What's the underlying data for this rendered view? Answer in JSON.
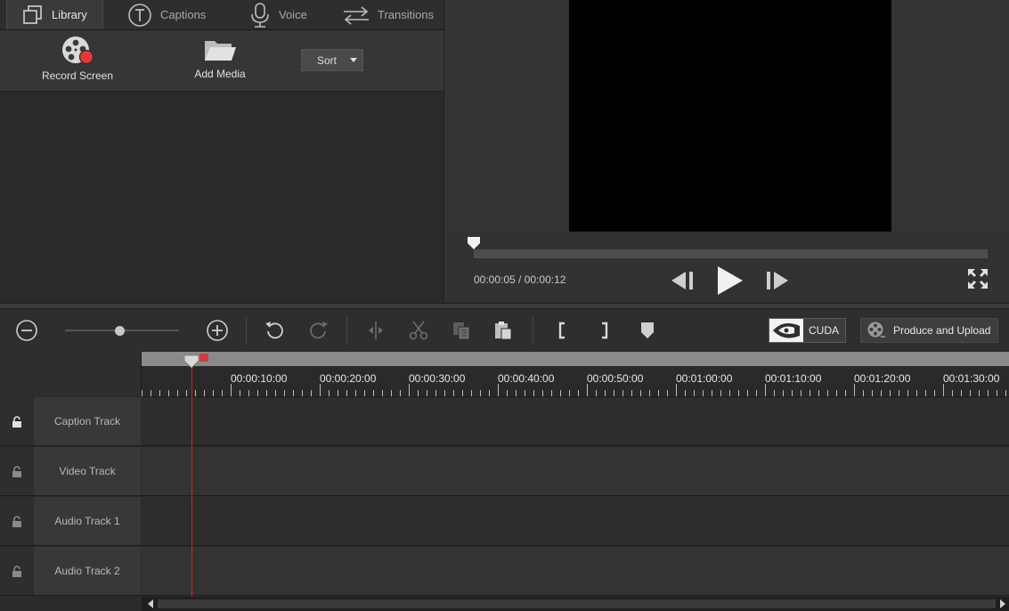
{
  "tabs": [
    {
      "label": "Library",
      "icon": "library-icon",
      "active": true
    },
    {
      "label": "Captions",
      "icon": "captions-icon",
      "active": false
    },
    {
      "label": "Voice",
      "icon": "microphone-icon",
      "active": false
    },
    {
      "label": "Transitions",
      "icon": "transitions-icon",
      "active": false
    }
  ],
  "library": {
    "record_label": "Record Screen",
    "add_media_label": "Add Media",
    "sort_label": "Sort"
  },
  "preview": {
    "time_readout": "00:00:05 / 00:00:12",
    "progress": 0.0
  },
  "toolbar": {
    "zoom_level": 0.48,
    "cuda_label": "CUDA",
    "produce_label": "Produce and Upload"
  },
  "timeline": {
    "ruler_labels": [
      "00:00:10:00",
      "00:00:20:00",
      "00:00:30:00",
      "00:00:40:00",
      "00:00:50:00",
      "00:01:00:00",
      "00:01:10:00",
      "00:01:20:00",
      "00:01:30:00"
    ],
    "tracks": [
      {
        "name": "Caption Track"
      },
      {
        "name": "Video Track"
      },
      {
        "name": "Audio Track 1"
      },
      {
        "name": "Audio Track 2"
      }
    ]
  },
  "colors": {
    "playhead": "#c0282c",
    "record_dot": "#e53935",
    "marker_in": "#3fae49",
    "marker_out": "#d23c3c"
  }
}
